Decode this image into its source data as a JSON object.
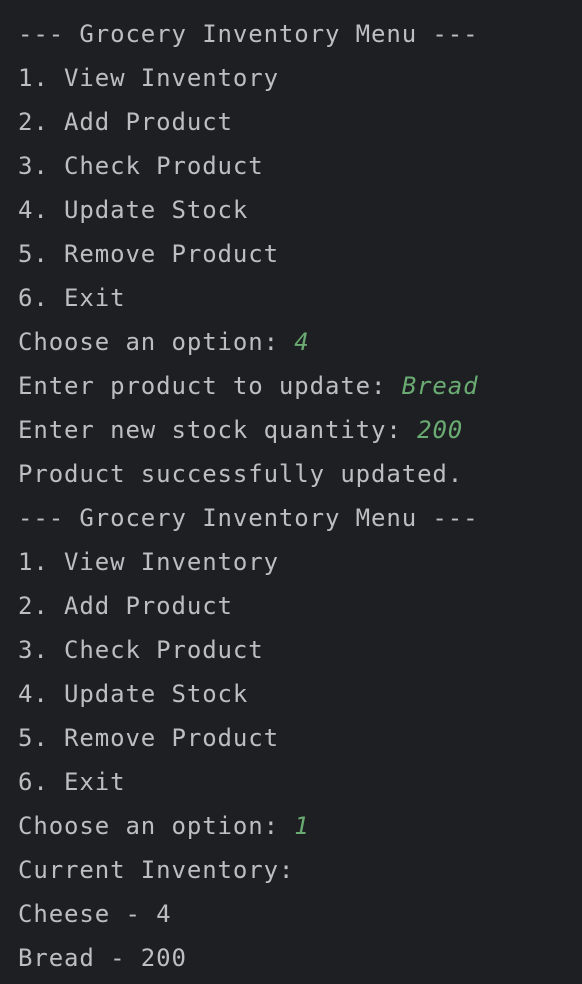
{
  "console": {
    "lines": [
      {
        "text": "--- Grocery Inventory Menu ---"
      },
      {
        "text": "1. View Inventory"
      },
      {
        "text": "2. Add Product"
      },
      {
        "text": "3. Check Product"
      },
      {
        "text": "4. Update Stock"
      },
      {
        "text": "5. Remove Product"
      },
      {
        "text": "6. Exit"
      },
      {
        "prompt": "Choose an option: ",
        "input": "4"
      },
      {
        "prompt": "Enter product to update: ",
        "input": "Bread"
      },
      {
        "prompt": "Enter new stock quantity: ",
        "input": "200"
      },
      {
        "text": "Product successfully updated."
      },
      {
        "text": "--- Grocery Inventory Menu ---"
      },
      {
        "text": "1. View Inventory"
      },
      {
        "text": "2. Add Product"
      },
      {
        "text": "3. Check Product"
      },
      {
        "text": "4. Update Stock"
      },
      {
        "text": "5. Remove Product"
      },
      {
        "text": "6. Exit"
      },
      {
        "prompt": "Choose an option: ",
        "input": "1"
      },
      {
        "text": "Current Inventory:"
      },
      {
        "text": "Cheese - 4"
      },
      {
        "text": "Bread - 200"
      }
    ]
  },
  "colors": {
    "background": "#1e1f22",
    "output_text": "#bcbec4",
    "user_input": "#6aab73"
  }
}
